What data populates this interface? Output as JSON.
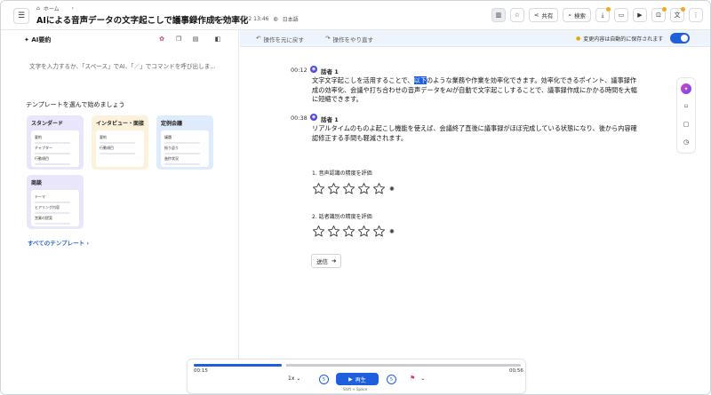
{
  "header": {
    "breadcrumb_home": "ホーム",
    "title": "AIによる音声データの文字起こしで議事録作成を効率化",
    "date": "2025/01/22 13:46",
    "language": "日本語",
    "share_label": "共有",
    "search_label": "検索"
  },
  "left_panel": {
    "ai_label": "AI要約",
    "prompt_placeholder": "文字を入力するか、「スペース」でAI、「／」でコマンドを呼び出しま...",
    "templates_heading": "テンプレートを選んで始めましょう",
    "templates": [
      {
        "title": "スタンダード",
        "items": [
          "要約",
          "チャプター",
          "行動項目"
        ]
      },
      {
        "title": "インタビュー・面接",
        "items": [
          "要約",
          "行動項目"
        ]
      },
      {
        "title": "定例会議",
        "items": [
          "議題",
          "振り返り",
          "進捗状況"
        ]
      },
      {
        "title": "商談",
        "items": [
          "テーマ",
          "ヒアリング内容",
          "営業の提案"
        ]
      }
    ],
    "all_templates_link": "すべてのテンプレート"
  },
  "toolbar": {
    "undo_label": "操作を元に戻す",
    "redo_label": "操作をやり直す",
    "autosave_label": "変更内容は自動的に保存されます"
  },
  "transcript": [
    {
      "time": "00:12",
      "speaker": "話者 1",
      "text_before": "文字文字起こしを活用することで、",
      "text_highlight": "以下",
      "text_after": "のような業務や作業を効率化できます。効率化できるポイント、議事録作成の効率化、会議や打ち合わせの音声データをAIが自動で文字起こしすることで、議事録作成にかかる時間を大幅に短縮できます。"
    },
    {
      "time": "00:38",
      "speaker": "話者 1",
      "text": "リアルタイムのものよ起こし機能を使えば、会議終了直後に議事録がほぼ完成している状態になり、後から内容確認修正する手間も軽減されます。"
    }
  ],
  "survey": {
    "q1": "1. 音声認識の精度を評価",
    "q2": "2. 話者識別の精度を評価",
    "star_count": 5,
    "send_label": "送信"
  },
  "player": {
    "current_time": "00:15",
    "duration": "00:56",
    "progress_fraction": 0.27,
    "speed": "1x",
    "skip_back": "5",
    "skip_forward": "5",
    "play_label": "再生",
    "play_hint": "Shift + Space"
  },
  "colors": {
    "accent": "#1e5fe0",
    "bookmark": "#e0334e"
  }
}
